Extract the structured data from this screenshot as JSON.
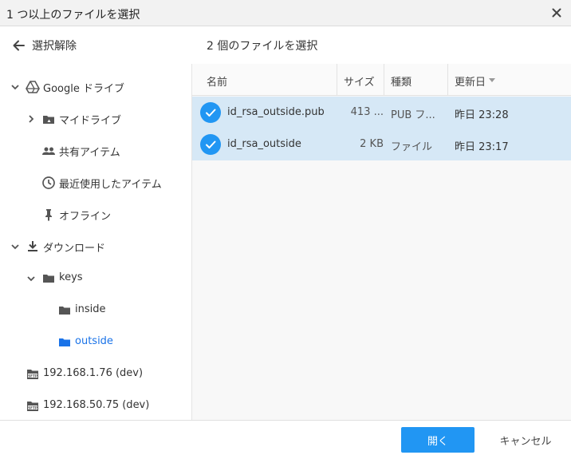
{
  "window": {
    "title": "1 つ以上のファイルを選択"
  },
  "toolbar": {
    "clear_selection": "選択解除",
    "selection_count": "2 個のファイルを選択"
  },
  "sidebar": {
    "items": [
      {
        "label": "Google ドライブ",
        "icon": "google-drive-icon",
        "chevron": "down"
      },
      {
        "label": "マイドライブ",
        "icon": "my-drive-icon",
        "chevron": "right"
      },
      {
        "label": "共有アイテム",
        "icon": "shared-people-icon"
      },
      {
        "label": "最近使用したアイテム",
        "icon": "clock-icon"
      },
      {
        "label": "オフライン",
        "icon": "pin-icon"
      },
      {
        "label": "ダウンロード",
        "icon": "download-icon",
        "chevron": "down"
      },
      {
        "label": "keys",
        "icon": "folder-icon",
        "chevron": "down"
      },
      {
        "label": "inside",
        "icon": "folder-icon"
      },
      {
        "label": "outside",
        "icon": "folder-icon",
        "active": true
      },
      {
        "label": "192.168.1.76 (dev)",
        "icon": "sftp-icon"
      },
      {
        "label": "192.168.50.75 (dev)",
        "icon": "sftp-icon"
      }
    ]
  },
  "file_list": {
    "columns": {
      "name": "名前",
      "size": "サイズ",
      "type": "種類",
      "modified": "更新日"
    },
    "rows": [
      {
        "name": "id_rsa_outside.pub",
        "size": "413 ...",
        "type": "PUB フ...",
        "modified": "昨日 23:28"
      },
      {
        "name": "id_rsa_outside",
        "size": "2 KB",
        "type": "ファイル",
        "modified": "昨日 23:17"
      }
    ]
  },
  "footer": {
    "open_label": "開く",
    "cancel_label": "キャンセル"
  },
  "colors": {
    "accent": "#2196f3",
    "selected_row": "#d6e8f6",
    "active_text": "#1a73e8"
  }
}
